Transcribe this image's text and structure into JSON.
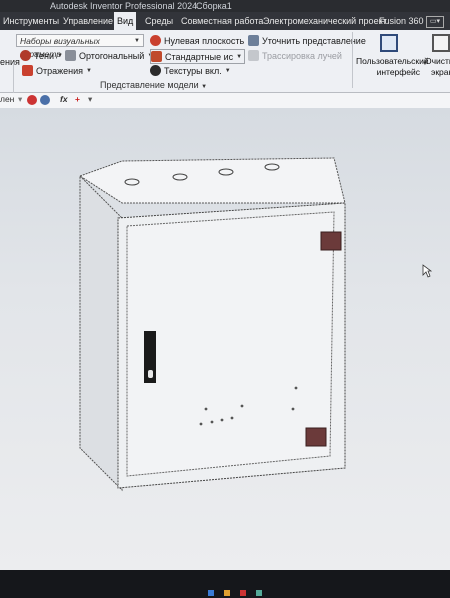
{
  "window": {
    "title": "Autodesk Inventor Professional 2024",
    "document": "Сборка1"
  },
  "tabs": [
    {
      "label": "Инструменты",
      "active": false
    },
    {
      "label": "Управление",
      "active": false
    },
    {
      "label": "Вид",
      "active": true
    },
    {
      "label": "Среды",
      "active": false
    },
    {
      "label": "Совместная работа",
      "active": false
    },
    {
      "label": "Электромеханический проект",
      "active": false
    },
    {
      "label": "Fusion 360",
      "active": false
    }
  ],
  "ribbon": {
    "visual_style_combo": "Наборы визуальных параметр",
    "ground_plane": "Нулевая плоскость",
    "refine_view": "Уточнить представление",
    "shadows": "Тени",
    "orthographic": "Ортогональный",
    "standard_display": "Стандартные ис",
    "ray_tracing": "Трассировка лучей",
    "reflections": "Отражения",
    "textures": "Текстуры вкл.",
    "panel_label": "Представление модели",
    "left_partial_top": "ения",
    "user_interface_line1": "Пользовательский",
    "user_interface_line2": "интерфейс",
    "clean_screen_line1": "Очисти",
    "clean_screen_line2": "экран"
  },
  "quickbar": {
    "left_text": "лен",
    "fx": "fx"
  },
  "colors": {
    "accent_tab": "#eceef2",
    "cabinet_body": "#eef0f2",
    "hinge": "#6b3a3a",
    "viewport_bg": "#dde1e6"
  }
}
